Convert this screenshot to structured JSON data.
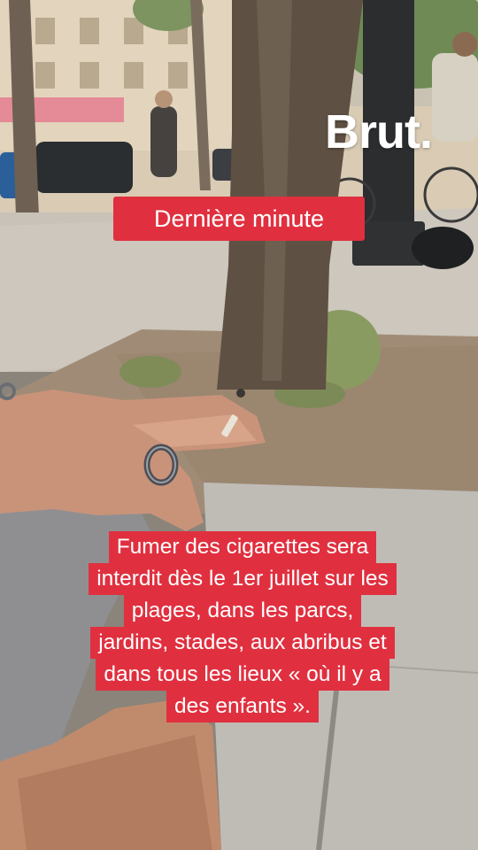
{
  "overlay": {
    "watermark": "Brut.",
    "tag": "Dernière minute",
    "caption_lines": [
      "Fumer des cigarettes sera",
      "interdit dès le 1er juillet sur les",
      "plages, dans les parcs,",
      "jardins, stades, aux abribus et",
      "dans tous les lieux « où il y a",
      "des enfants »."
    ]
  },
  "colors": {
    "accent_red": "#e0303f",
    "text": "#ffffff"
  }
}
